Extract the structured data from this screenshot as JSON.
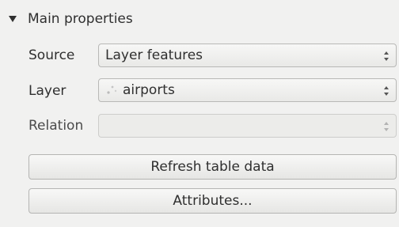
{
  "section": {
    "title": "Main properties",
    "expanded": true
  },
  "fields": {
    "source": {
      "label": "Source",
      "value": "Layer features"
    },
    "layer": {
      "label": "Layer",
      "value": "airports",
      "icon": "point-layer-icon"
    },
    "relation": {
      "label": "Relation",
      "value": "",
      "disabled": true
    }
  },
  "buttons": {
    "refresh": "Refresh table data",
    "attributes": "Attributes..."
  }
}
